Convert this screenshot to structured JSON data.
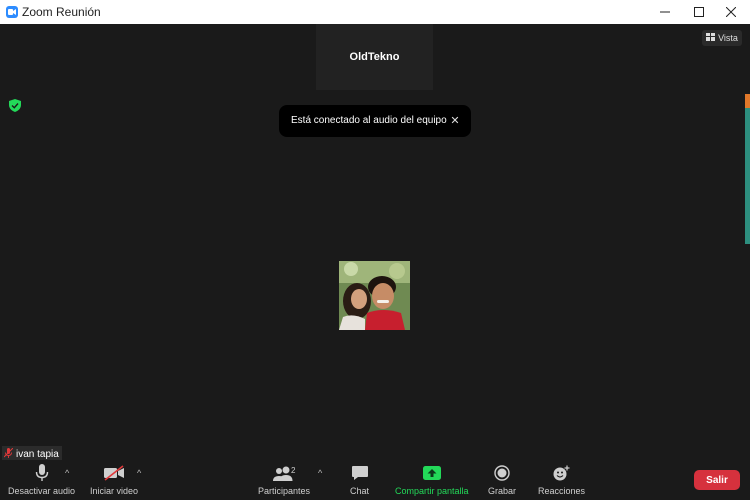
{
  "window": {
    "title": "Zoom Reunión"
  },
  "participant_tile": {
    "name": "OldTekno"
  },
  "view_button": {
    "label": "Vista"
  },
  "toast": {
    "message": "Está conectado al audio del equipo"
  },
  "self_view": {
    "name": "ivan tapia"
  },
  "toolbar": {
    "audio_label": "Desactivar audio",
    "video_label": "Iniciar video",
    "participants_label": "Participantes",
    "participants_count": "2",
    "chat_label": "Chat",
    "share_label": "Compartir pantalla",
    "record_label": "Grabar",
    "reactions_label": "Reacciones",
    "leave_label": "Salir"
  },
  "colors": {
    "background": "#1a1a1a",
    "share_green": "#23d959",
    "leave_red": "#d6313d",
    "security_green": "#23d959",
    "zoom_blue": "#2d8cff"
  }
}
